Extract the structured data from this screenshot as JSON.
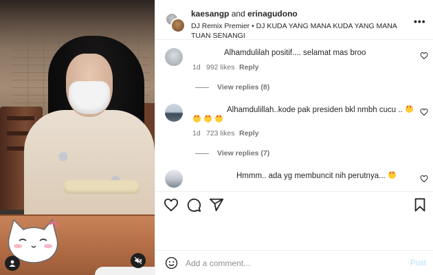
{
  "post": {
    "author_1": "kaesangp",
    "joiner": "and",
    "author_2": "erinagudono",
    "audio": "DJ Remix Premier • DJ KUDA YANG MANA KUDA YANG MANA TUAN SENANGI",
    "more": "•••"
  },
  "comments": [
    {
      "text": "Alhamdulilah positif.... selamat mas broo",
      "emojis": 0,
      "time": "1d",
      "likes": "992 likes",
      "reply": "Reply",
      "view_replies": "View replies (8)"
    },
    {
      "text": "Alhamdulillah..kode pak presiden bkl nmbh cucu ..",
      "emojis": 4,
      "time": "1d",
      "likes": "723 likes",
      "reply": "Reply",
      "view_replies": "View replies (7)"
    },
    {
      "text": "Hmmm.. ada yg membuncit nih perutnya...",
      "emojis": 1
    }
  ],
  "add_comment": {
    "placeholder": "Add a comment...",
    "post": "Post"
  },
  "icons": [
    "heart-icon",
    "comment-icon",
    "share-icon",
    "bookmark-icon",
    "emoji-icon",
    "mute-icon",
    "user-icon"
  ],
  "colors": {
    "post_disabled": "#b2dffc",
    "secondary_text": "#737373"
  }
}
